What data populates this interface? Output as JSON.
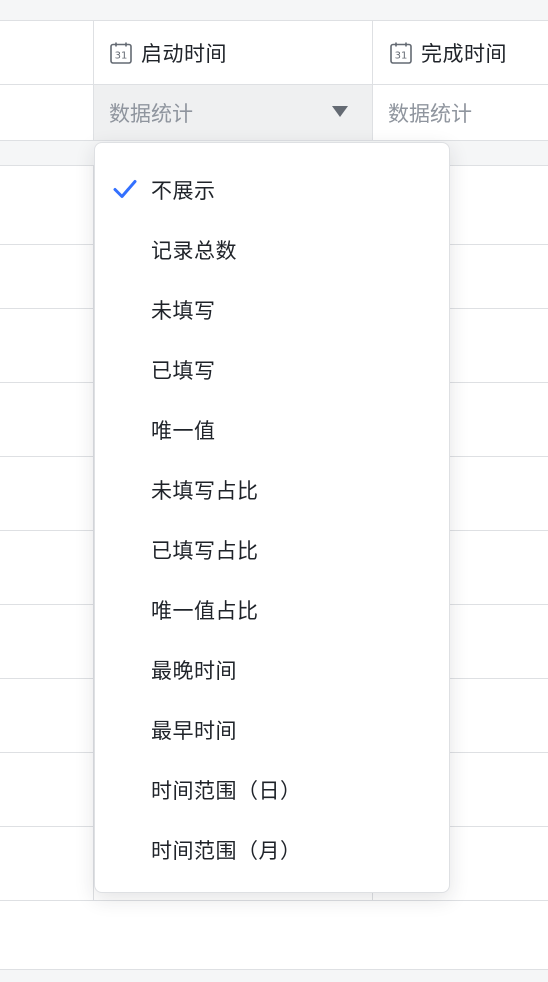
{
  "columns": [
    {
      "icon": "calendar-icon",
      "icon_text": "31",
      "title": "启动时间",
      "stat_placeholder": "数据统计"
    },
    {
      "icon": "calendar-icon",
      "icon_text": "31",
      "title": "完成时间",
      "stat_placeholder": "数据统计"
    }
  ],
  "dropdown": {
    "selected_index": 0,
    "items": [
      {
        "label": "不展示"
      },
      {
        "label": "记录总数"
      },
      {
        "label": "未填写"
      },
      {
        "label": "已填写"
      },
      {
        "label": "唯一值"
      },
      {
        "label": "未填写占比"
      },
      {
        "label": "已填写占比"
      },
      {
        "label": "唯一值占比"
      },
      {
        "label": "最晚时间"
      },
      {
        "label": "最早时间"
      },
      {
        "label": "时间范围（日）"
      },
      {
        "label": "时间范围（月）"
      }
    ]
  },
  "colors": {
    "accent": "#3370ff",
    "border": "#dee0e3",
    "text": "#1f2329",
    "muted": "#8f959e"
  }
}
